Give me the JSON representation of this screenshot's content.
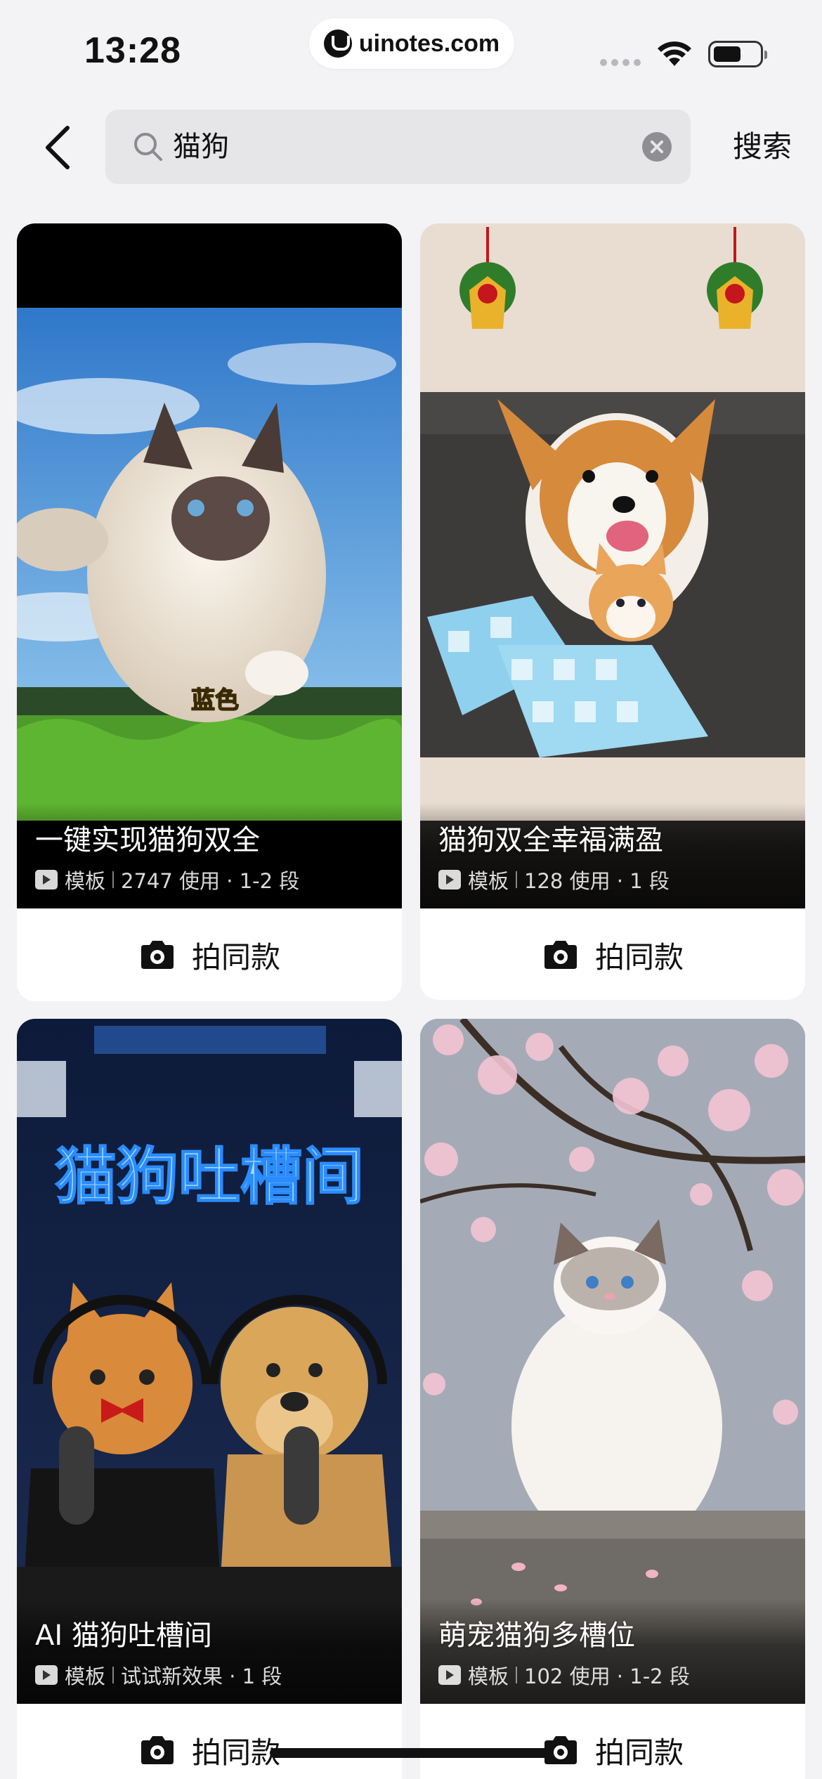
{
  "status_bar": {
    "time": "13:28",
    "url": "uinotes.com",
    "icons": [
      "cellular-icon",
      "wifi-icon",
      "battery-icon"
    ]
  },
  "header": {
    "back_icon": "chevron-left-icon",
    "search": {
      "value": "猫狗",
      "icon": "search-icon",
      "clear_icon": "clear-icon"
    },
    "submit_label": "搜索"
  },
  "cards": [
    {
      "title": "一键实现猫狗双全",
      "type_label": "模板",
      "usage": "2747 使用 · 1-2 段",
      "image_caption": "蓝色",
      "action_label": "拍同款"
    },
    {
      "title": "猫狗双全幸福满盈",
      "type_label": "模板",
      "usage": "128 使用 · 1 段",
      "action_label": "拍同款"
    },
    {
      "title": "AI 猫狗吐槽间",
      "type_label": "模板",
      "usage": "试试新效果 · 1 段",
      "image_caption": "猫狗吐槽间",
      "action_label": "拍同款"
    },
    {
      "title": "萌宠猫狗多槽位",
      "type_label": "模板",
      "usage": "102 使用 · 1-2 段",
      "action_label": "拍同款"
    }
  ],
  "colors": {
    "background": "#f3f3f5",
    "card": "#ffffff",
    "search_field": "#e6e6e9",
    "neon_text": "#9fd8ff"
  }
}
